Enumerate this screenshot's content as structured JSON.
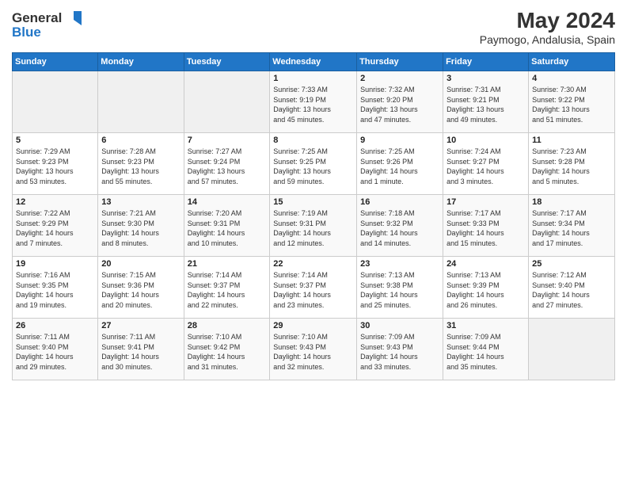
{
  "header": {
    "logo_line1": "General",
    "logo_line2": "Blue",
    "month_year": "May 2024",
    "location": "Paymogo, Andalusia, Spain"
  },
  "weekdays": [
    "Sunday",
    "Monday",
    "Tuesday",
    "Wednesday",
    "Thursday",
    "Friday",
    "Saturday"
  ],
  "weeks": [
    [
      {
        "day": "",
        "info": ""
      },
      {
        "day": "",
        "info": ""
      },
      {
        "day": "",
        "info": ""
      },
      {
        "day": "1",
        "info": "Sunrise: 7:33 AM\nSunset: 9:19 PM\nDaylight: 13 hours\nand 45 minutes."
      },
      {
        "day": "2",
        "info": "Sunrise: 7:32 AM\nSunset: 9:20 PM\nDaylight: 13 hours\nand 47 minutes."
      },
      {
        "day": "3",
        "info": "Sunrise: 7:31 AM\nSunset: 9:21 PM\nDaylight: 13 hours\nand 49 minutes."
      },
      {
        "day": "4",
        "info": "Sunrise: 7:30 AM\nSunset: 9:22 PM\nDaylight: 13 hours\nand 51 minutes."
      }
    ],
    [
      {
        "day": "5",
        "info": "Sunrise: 7:29 AM\nSunset: 9:23 PM\nDaylight: 13 hours\nand 53 minutes."
      },
      {
        "day": "6",
        "info": "Sunrise: 7:28 AM\nSunset: 9:23 PM\nDaylight: 13 hours\nand 55 minutes."
      },
      {
        "day": "7",
        "info": "Sunrise: 7:27 AM\nSunset: 9:24 PM\nDaylight: 13 hours\nand 57 minutes."
      },
      {
        "day": "8",
        "info": "Sunrise: 7:25 AM\nSunset: 9:25 PM\nDaylight: 13 hours\nand 59 minutes."
      },
      {
        "day": "9",
        "info": "Sunrise: 7:25 AM\nSunset: 9:26 PM\nDaylight: 14 hours\nand 1 minute."
      },
      {
        "day": "10",
        "info": "Sunrise: 7:24 AM\nSunset: 9:27 PM\nDaylight: 14 hours\nand 3 minutes."
      },
      {
        "day": "11",
        "info": "Sunrise: 7:23 AM\nSunset: 9:28 PM\nDaylight: 14 hours\nand 5 minutes."
      }
    ],
    [
      {
        "day": "12",
        "info": "Sunrise: 7:22 AM\nSunset: 9:29 PM\nDaylight: 14 hours\nand 7 minutes."
      },
      {
        "day": "13",
        "info": "Sunrise: 7:21 AM\nSunset: 9:30 PM\nDaylight: 14 hours\nand 8 minutes."
      },
      {
        "day": "14",
        "info": "Sunrise: 7:20 AM\nSunset: 9:31 PM\nDaylight: 14 hours\nand 10 minutes."
      },
      {
        "day": "15",
        "info": "Sunrise: 7:19 AM\nSunset: 9:31 PM\nDaylight: 14 hours\nand 12 minutes."
      },
      {
        "day": "16",
        "info": "Sunrise: 7:18 AM\nSunset: 9:32 PM\nDaylight: 14 hours\nand 14 minutes."
      },
      {
        "day": "17",
        "info": "Sunrise: 7:17 AM\nSunset: 9:33 PM\nDaylight: 14 hours\nand 15 minutes."
      },
      {
        "day": "18",
        "info": "Sunrise: 7:17 AM\nSunset: 9:34 PM\nDaylight: 14 hours\nand 17 minutes."
      }
    ],
    [
      {
        "day": "19",
        "info": "Sunrise: 7:16 AM\nSunset: 9:35 PM\nDaylight: 14 hours\nand 19 minutes."
      },
      {
        "day": "20",
        "info": "Sunrise: 7:15 AM\nSunset: 9:36 PM\nDaylight: 14 hours\nand 20 minutes."
      },
      {
        "day": "21",
        "info": "Sunrise: 7:14 AM\nSunset: 9:37 PM\nDaylight: 14 hours\nand 22 minutes."
      },
      {
        "day": "22",
        "info": "Sunrise: 7:14 AM\nSunset: 9:37 PM\nDaylight: 14 hours\nand 23 minutes."
      },
      {
        "day": "23",
        "info": "Sunrise: 7:13 AM\nSunset: 9:38 PM\nDaylight: 14 hours\nand 25 minutes."
      },
      {
        "day": "24",
        "info": "Sunrise: 7:13 AM\nSunset: 9:39 PM\nDaylight: 14 hours\nand 26 minutes."
      },
      {
        "day": "25",
        "info": "Sunrise: 7:12 AM\nSunset: 9:40 PM\nDaylight: 14 hours\nand 27 minutes."
      }
    ],
    [
      {
        "day": "26",
        "info": "Sunrise: 7:11 AM\nSunset: 9:40 PM\nDaylight: 14 hours\nand 29 minutes."
      },
      {
        "day": "27",
        "info": "Sunrise: 7:11 AM\nSunset: 9:41 PM\nDaylight: 14 hours\nand 30 minutes."
      },
      {
        "day": "28",
        "info": "Sunrise: 7:10 AM\nSunset: 9:42 PM\nDaylight: 14 hours\nand 31 minutes."
      },
      {
        "day": "29",
        "info": "Sunrise: 7:10 AM\nSunset: 9:43 PM\nDaylight: 14 hours\nand 32 minutes."
      },
      {
        "day": "30",
        "info": "Sunrise: 7:09 AM\nSunset: 9:43 PM\nDaylight: 14 hours\nand 33 minutes."
      },
      {
        "day": "31",
        "info": "Sunrise: 7:09 AM\nSunset: 9:44 PM\nDaylight: 14 hours\nand 35 minutes."
      },
      {
        "day": "",
        "info": ""
      }
    ]
  ]
}
